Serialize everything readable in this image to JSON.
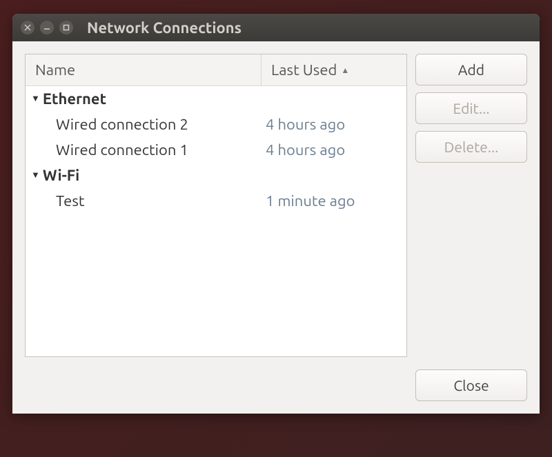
{
  "window": {
    "title": "Network Connections"
  },
  "columns": {
    "name": "Name",
    "last_used": "Last Used"
  },
  "groups": [
    {
      "label": "Ethernet",
      "items": [
        {
          "name": "Wired connection 2",
          "last_used": "4 hours ago"
        },
        {
          "name": "Wired connection 1",
          "last_used": "4 hours ago"
        }
      ]
    },
    {
      "label": "Wi-Fi",
      "items": [
        {
          "name": "Test",
          "last_used": "1 minute ago"
        }
      ]
    }
  ],
  "buttons": {
    "add": "Add",
    "edit": "Edit...",
    "delete": "Delete...",
    "close": "Close"
  }
}
